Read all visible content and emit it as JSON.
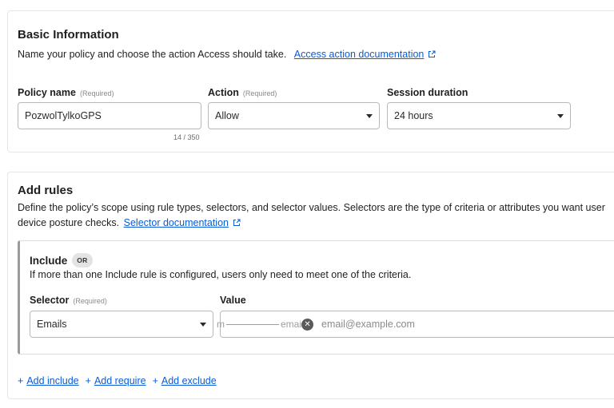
{
  "basic": {
    "title": "Basic Information",
    "description": "Name your policy and choose the action Access should take.",
    "doc_link": "Access action documentation",
    "policy_name": {
      "label": "Policy name",
      "required": "(Required)",
      "value": "PozwolTylkoGPS",
      "counter": "14 / 350"
    },
    "action": {
      "label": "Action",
      "required": "(Required)",
      "value": "Allow"
    },
    "session": {
      "label": "Session duration",
      "value": "24 hours"
    }
  },
  "rules": {
    "title": "Add rules",
    "description_line1": "Define the policy’s scope using rule types, selectors, and selector values. Selectors are the type of criteria or attributes you want user",
    "description_line2": "device posture checks.",
    "doc_link": "Selector documentation",
    "include": {
      "title": "Include",
      "badge": "OR",
      "description": "If more than one Include rule is configured, users only need to meet one of the criteria.",
      "selector": {
        "label": "Selector",
        "required": "(Required)",
        "value": "Emails"
      },
      "value": {
        "label": "Value",
        "tag_prefix": "m",
        "tag_text": "emai",
        "placeholder": "email@example.com"
      }
    },
    "add_links": [
      {
        "plus": "+",
        "label": "Add include"
      },
      {
        "plus": "+",
        "label": "Add require"
      },
      {
        "plus": "+",
        "label": "Add exclude"
      }
    ]
  },
  "colors": {
    "link": "#0a5bd6",
    "border": "#b9b9b9",
    "badge_bg": "#e3e3e3"
  },
  "icons": {
    "external_link": "external-link-icon",
    "dropdown": "chevron-down-icon",
    "remove": "close-icon"
  }
}
